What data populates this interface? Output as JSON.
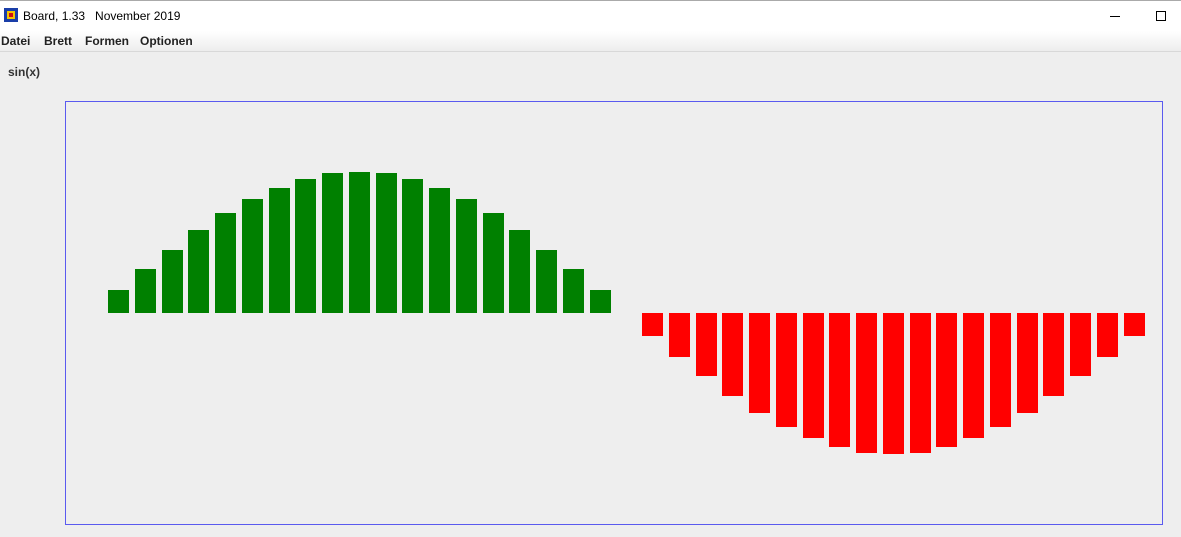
{
  "window": {
    "title": "Board, 1.33   November 2019",
    "minimize_glyph": "—",
    "maximize_glyph": "☐"
  },
  "menu": {
    "items": [
      "Datei",
      "Brett",
      "Formen",
      "Optionen"
    ]
  },
  "board": {
    "label": "sin(x)",
    "border_color": "#5a5aef"
  },
  "chart_data": {
    "type": "bar",
    "title": "sin(x)",
    "ylim": [
      -1,
      1
    ],
    "series": [
      {
        "color": "#008000",
        "values": [
          0.16,
          0.31,
          0.45,
          0.59,
          0.71,
          0.81,
          0.89,
          0.95,
          0.99,
          1.0,
          0.99,
          0.95,
          0.89,
          0.81,
          0.71,
          0.59,
          0.45,
          0.31,
          0.16
        ]
      },
      {
        "color": "#ff0000",
        "values": [
          -0.16,
          -0.31,
          -0.45,
          -0.59,
          -0.71,
          -0.81,
          -0.89,
          -0.95,
          -0.99,
          -1.0,
          -0.99,
          -0.95,
          -0.89,
          -0.81,
          -0.71,
          -0.59,
          -0.45,
          -0.31,
          -0.16
        ]
      }
    ]
  }
}
